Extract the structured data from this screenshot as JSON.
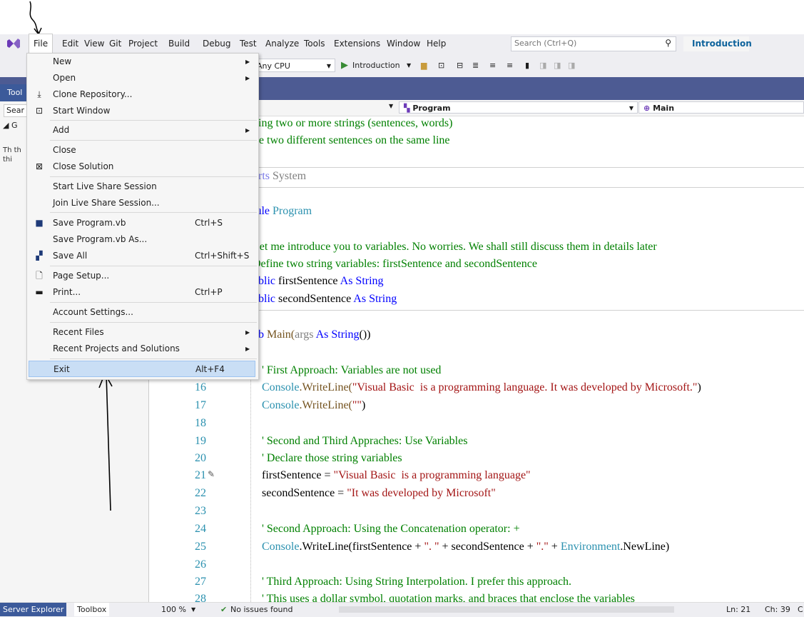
{
  "menubar": {
    "items": [
      "File",
      "Edit",
      "View",
      "Git",
      "Project",
      "Build",
      "Debug",
      "Test",
      "Analyze",
      "Tools",
      "Extensions",
      "Window",
      "Help"
    ],
    "search_placeholder": "Search (Ctrl+Q)",
    "solution_button": "Introduction"
  },
  "toolbar": {
    "platform": "Any CPU",
    "start": "Introduction"
  },
  "toolbox": {
    "title": "Tool",
    "search": "Sear",
    "group": "◢ G",
    "note": "Th th thi"
  },
  "navbar": {
    "class_combo": "Program",
    "method_combo": "Main"
  },
  "file_menu": {
    "items": [
      {
        "label": "New",
        "shortcut": "",
        "submenu": true
      },
      {
        "label": "Open",
        "shortcut": "",
        "submenu": true
      },
      {
        "label": "Clone Repository...",
        "shortcut": "",
        "submenu": false
      },
      {
        "label": "Start Window",
        "shortcut": "",
        "submenu": false
      },
      {
        "label": "Add",
        "shortcut": "",
        "submenu": true
      },
      {
        "label": "Close",
        "shortcut": "",
        "submenu": false
      },
      {
        "label": "Close Solution",
        "shortcut": "",
        "submenu": false
      },
      {
        "label": "Start Live Share Session",
        "shortcut": "",
        "submenu": false
      },
      {
        "label": "Join Live Share Session...",
        "shortcut": "",
        "submenu": false
      },
      {
        "label": "Save Program.vb",
        "shortcut": "Ctrl+S",
        "submenu": false
      },
      {
        "label": "Save Program.vb As...",
        "shortcut": "",
        "submenu": false
      },
      {
        "label": "Save All",
        "shortcut": "Ctrl+Shift+S",
        "submenu": false
      },
      {
        "label": "Page Setup...",
        "shortcut": "",
        "submenu": false
      },
      {
        "label": "Print...",
        "shortcut": "Ctrl+P",
        "submenu": false
      },
      {
        "label": "Account Settings...",
        "shortcut": "",
        "submenu": false
      },
      {
        "label": "Recent Files",
        "shortcut": "",
        "submenu": true
      },
      {
        "label": "Recent Projects and Solutions",
        "shortcut": "",
        "submenu": true
      },
      {
        "label": "Exit",
        "shortcut": "Alt+F4",
        "submenu": false
      }
    ]
  },
  "code": {
    "line1": "ning two or more strings (sentences, words)",
    "line2": "ite two different sentences on the same line",
    "imports_kw": "orts",
    "imports_ns": " System",
    "module_kw": "lule",
    "module_name": " Program",
    "c1": "Let me introduce you to variables. No worries. We shall still discuss them in details later",
    "c2": "Define two string variables: firstSentence and secondSentence",
    "pub1_kw": "ublic",
    "pub1_name": " firstSentence ",
    "pub1_as": "As String",
    "pub2_kw": "ublic",
    "pub2_name": " secondSentence ",
    "pub2_as": "As String",
    "sub_kw": "ub",
    "sub_name": " Main(",
    "sub_arg": "args",
    "sub_as": " As String",
    "sub_end": "())",
    "l15": "' First Approach: Variables are not used",
    "l16_cls": "Console",
    "l16_m": ".WriteLine(",
    "l16_s": "\"Visual Basic  is a programming language. It was developed by Microsoft.\"",
    "l16_e": ")",
    "l17_cls": "Console",
    "l17_m": ".WriteLine(",
    "l17_s": "\"\"",
    "l17_e": ")",
    "l19": "' Second and Third Appraches: Use Variables",
    "l20": "' Declare those string variables",
    "l21_v": "firstSentence = ",
    "l21_s": "\"Visual Basic  is a programming language\"",
    "l22_v": "secondSentence = ",
    "l22_s": "\"It was developed by Microsoft\"",
    "l24": "' Second Approach: Using the Concatenation operator: +",
    "l25_cls": "Console",
    "l25_m": ".WriteLine(firstSentence + ",
    "l25_s1": "\". \"",
    "l25_m2": " + secondSentence + ",
    "l25_s2": "\".\"",
    "l25_m3": " + ",
    "l25_env": "Environment",
    "l25_end": ".NewLine)",
    "l27": "' Third Approach: Using String Interpolation. I prefer this approach.",
    "l28": "' This uses a dollar symbol, quotation marks, and braces that enclose the variables",
    "line_numbers": [
      "16",
      "17",
      "18",
      "19",
      "20",
      "21",
      "22",
      "23",
      "24",
      "25",
      "26",
      "27",
      "28"
    ]
  },
  "statusbar": {
    "tab1": "Server Explorer",
    "tab2": "Toolbox",
    "zoom": "100 %",
    "issues": "No issues found",
    "ln": "Ln: 21",
    "ch": "Ch: 39",
    "col": "C"
  }
}
